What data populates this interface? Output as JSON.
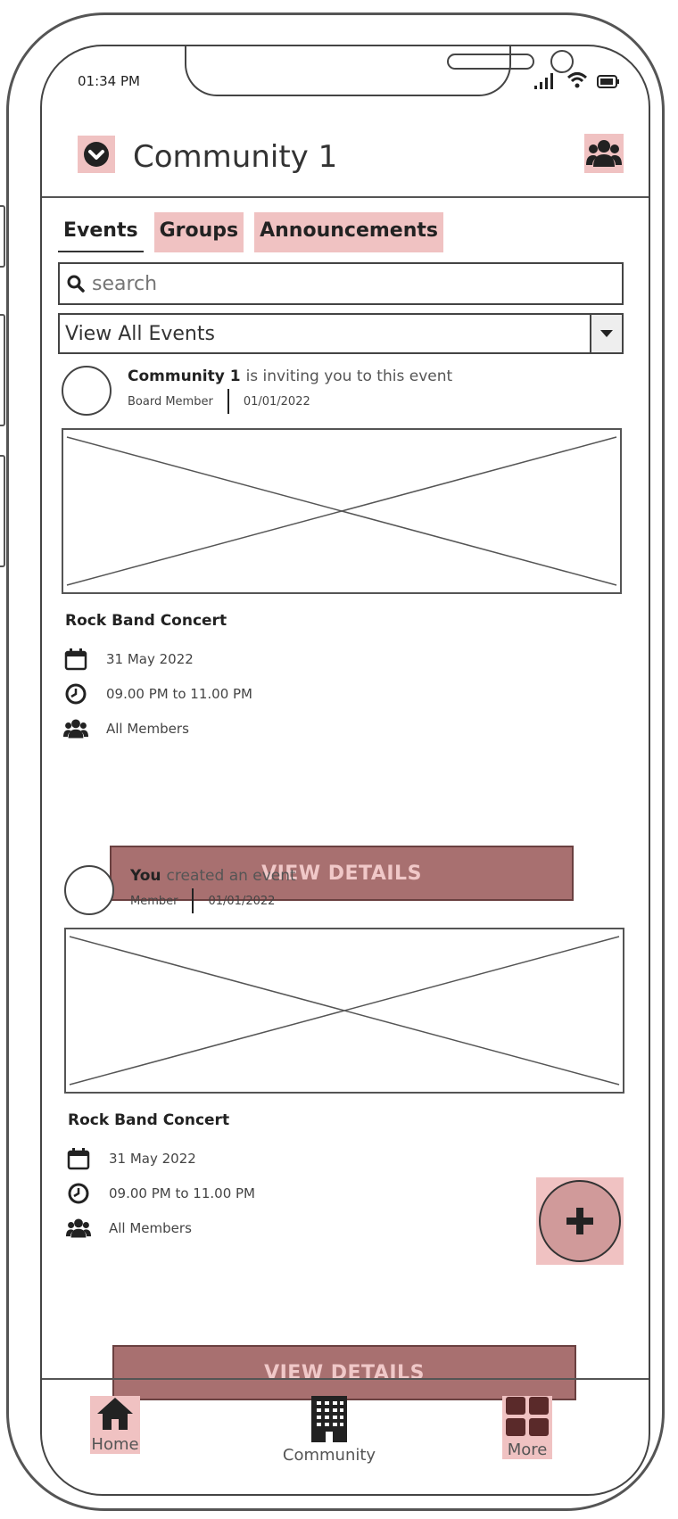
{
  "status": {
    "time": "01:34 PM"
  },
  "header": {
    "title": "Community 1"
  },
  "tabs": [
    "Events",
    "Groups",
    "Announcements"
  ],
  "search": {
    "placeholder": "search"
  },
  "filter": {
    "selected": "View All Events"
  },
  "posts": [
    {
      "author": "Community 1",
      "action": "is inviting you to this event",
      "role": "Board Member",
      "date": "01/01/2022",
      "event_title": "Rock Band Concert",
      "event_date": "31 May 2022",
      "event_time": "09.00 PM to 11.00 PM",
      "audience": "All Members",
      "button": "VIEW DETAILS"
    },
    {
      "author": "You",
      "action": "created an event",
      "role": "Member",
      "date": "01/01/2022",
      "event_title": "Rock Band Concert",
      "event_date": "31 May 2022",
      "event_time": "09.00 PM to 11.00 PM",
      "audience": "All Members",
      "button": "VIEW DETAILS"
    }
  ],
  "bottom_nav": [
    {
      "label": "Home",
      "icon": "home-icon"
    },
    {
      "label": "Community",
      "icon": "building-icon"
    },
    {
      "label": "More",
      "icon": "grid-icon"
    }
  ],
  "colors": {
    "highlight": "#f0c2c2",
    "button": "#a87070",
    "button_text": "#f0c8c8",
    "fab": "#d09a9a"
  }
}
